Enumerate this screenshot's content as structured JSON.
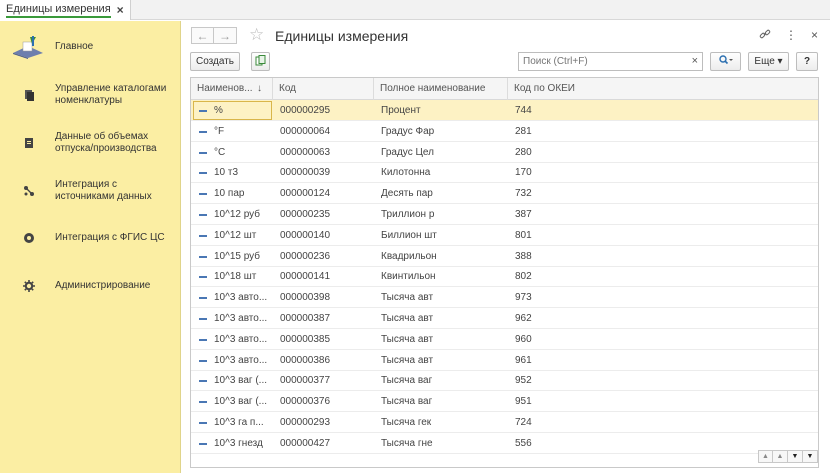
{
  "tabs": [
    {
      "label": "Единицы измерения",
      "close": "×"
    }
  ],
  "sidebar": {
    "items": [
      {
        "label": "Главное",
        "icon": "home-books-icon"
      },
      {
        "label": "Управление каталогами номенклатуры",
        "icon": "catalog-icon"
      },
      {
        "label": "Данные об объемах отпуска/производства",
        "icon": "document-icon"
      },
      {
        "label": "Интеграция с источниками данных",
        "icon": "integration-icon"
      },
      {
        "label": "Интеграция с ФГИС ЦС",
        "icon": "fgis-icon"
      },
      {
        "label": "Администрирование",
        "icon": "gear-icon"
      }
    ]
  },
  "header": {
    "title": "Единицы измерения",
    "back": "←",
    "forward": "→",
    "star": "☆",
    "link_icon": "🔗",
    "more_icon": "⋮",
    "close_icon": "×"
  },
  "toolbar": {
    "create_label": "Создать",
    "search_placeholder": "Поиск (Ctrl+F)",
    "search_clear": "×",
    "search_btn": "🔍 ▾",
    "more_label": "Еще ▾",
    "help_label": "?"
  },
  "table": {
    "columns": [
      "Наименов...",
      "Код",
      "Полное наименование",
      "Код по ОКЕИ"
    ],
    "sort_indicator": "↓",
    "rows": [
      {
        "name": "%",
        "code": "000000295",
        "full": "Процент",
        "okei": "744"
      },
      {
        "name": "°F",
        "code": "000000064",
        "full": "Градус Фар",
        "okei": "281"
      },
      {
        "name": "°C",
        "code": "000000063",
        "full": "Градус Цел",
        "okei": "280"
      },
      {
        "name": "10  т3",
        "code": "000000039",
        "full": "Килотонна",
        "okei": "170"
      },
      {
        "name": "10 пар",
        "code": "000000124",
        "full": "Десять пар",
        "okei": "732"
      },
      {
        "name": "10^12 руб",
        "code": "000000235",
        "full": "Триллион р",
        "okei": "387"
      },
      {
        "name": "10^12 шт",
        "code": "000000140",
        "full": "Биллион шт",
        "okei": "801"
      },
      {
        "name": "10^15 руб",
        "code": "000000236",
        "full": "Квадрильон",
        "okei": "388"
      },
      {
        "name": "10^18 шт",
        "code": "000000141",
        "full": "Квинтильон",
        "okei": "802"
      },
      {
        "name": "10^3  авто...",
        "code": "000000398",
        "full": "Тысяча авт",
        "okei": "973"
      },
      {
        "name": "10^3  авто...",
        "code": "000000387",
        "full": "Тысяча авт",
        "okei": "962"
      },
      {
        "name": "10^3  авто...",
        "code": "000000385",
        "full": "Тысяча авт",
        "okei": "960"
      },
      {
        "name": "10^3  авто...",
        "code": "000000386",
        "full": "Тысяча авт",
        "okei": "961"
      },
      {
        "name": "10^3  ваг (...",
        "code": "000000377",
        "full": "Тысяча ваг",
        "okei": "952"
      },
      {
        "name": "10^3  ваг (...",
        "code": "000000376",
        "full": "Тысяча ваг",
        "okei": "951"
      },
      {
        "name": "10^3  га п...",
        "code": "000000293",
        "full": "Тысяча гек",
        "okei": "724"
      },
      {
        "name": "10^3  гнезд",
        "code": "000000427",
        "full": "Тысяча гне",
        "okei": "556"
      }
    ]
  },
  "scroll": {
    "first": "▲",
    "up": "▲",
    "down": "▼",
    "last": "▼"
  }
}
